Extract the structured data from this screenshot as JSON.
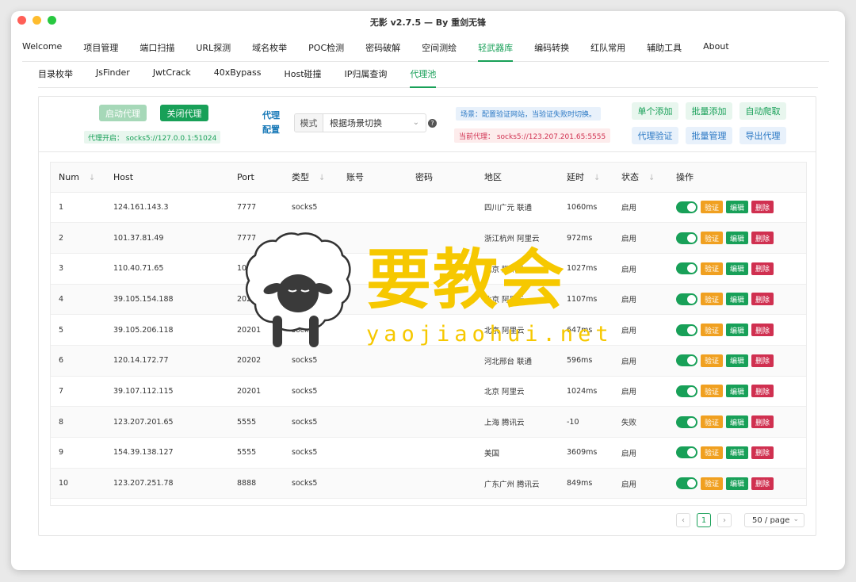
{
  "window": {
    "title": "无影 v2.7.5 — By 重剑无锋"
  },
  "main_tabs": [
    {
      "label": "Welcome"
    },
    {
      "label": "项目管理"
    },
    {
      "label": "端口扫描"
    },
    {
      "label": "URL探测"
    },
    {
      "label": "域名枚举"
    },
    {
      "label": "POC检测"
    },
    {
      "label": "密码破解"
    },
    {
      "label": "空间测绘"
    },
    {
      "label": "轻武器库"
    },
    {
      "label": "编码转换"
    },
    {
      "label": "红队常用"
    },
    {
      "label": "辅助工具"
    },
    {
      "label": "About"
    }
  ],
  "active_main_tab": "轻武器库",
  "sub_tabs": [
    {
      "label": "目录枚举"
    },
    {
      "label": "JsFinder"
    },
    {
      "label": "JwtCrack"
    },
    {
      "label": "40xBypass"
    },
    {
      "label": "Host碰撞"
    },
    {
      "label": "IP归属查询"
    },
    {
      "label": "代理池"
    }
  ],
  "active_sub_tab": "代理池",
  "toolbar": {
    "start_label": "启动代理",
    "stop_label": "关闭代理",
    "proxy_on_text": "代理开启： socks5://127.0.0.1:51024",
    "config_label": "代理配置",
    "mode_prefix": "模式",
    "mode_value": "根据场景切换",
    "help_icon": "?",
    "scene_text": "场景：配置验证网站，当验证失败时切换。",
    "current_proxy_text": "当前代理： socks5://123.207.201.65:5555",
    "add_one": "单个添加",
    "add_batch": "批量添加",
    "auto_crawl": "自动爬取",
    "verify": "代理验证",
    "batch_manage": "批量管理",
    "export": "导出代理"
  },
  "table": {
    "columns": [
      "Num",
      "Host",
      "Port",
      "类型",
      "账号",
      "密码",
      "地区",
      "延时",
      "状态",
      "操作"
    ],
    "ops": {
      "verify": "验证",
      "edit": "编辑",
      "delete": "删除"
    },
    "rows": [
      {
        "num": "1",
        "host": "124.161.143.3",
        "port": "7777",
        "type": "socks5",
        "account": "",
        "password": "",
        "region": "四川广元 联通",
        "delay": "1060ms",
        "status": "启用"
      },
      {
        "num": "2",
        "host": "101.37.81.49",
        "port": "7777",
        "type": "socks5",
        "account": "",
        "password": "",
        "region": "浙江杭州 阿里云",
        "delay": "972ms",
        "status": "启用"
      },
      {
        "num": "3",
        "host": "110.40.71.65",
        "port": "1080",
        "type": "socks5",
        "account": "",
        "password": "",
        "region": "北京 腾讯云",
        "delay": "1027ms",
        "status": "启用"
      },
      {
        "num": "4",
        "host": "39.105.154.188",
        "port": "20201",
        "type": "socks5",
        "account": "",
        "password": "",
        "region": "北京 阿里云",
        "delay": "1107ms",
        "status": "启用"
      },
      {
        "num": "5",
        "host": "39.105.206.118",
        "port": "20201",
        "type": "socks5",
        "account": "",
        "password": "",
        "region": "北京 阿里云",
        "delay": "647ms",
        "status": "启用"
      },
      {
        "num": "6",
        "host": "120.14.172.77",
        "port": "20202",
        "type": "socks5",
        "account": "",
        "password": "",
        "region": "河北邢台 联通",
        "delay": "596ms",
        "status": "启用"
      },
      {
        "num": "7",
        "host": "39.107.112.115",
        "port": "20201",
        "type": "socks5",
        "account": "",
        "password": "",
        "region": "北京 阿里云",
        "delay": "1024ms",
        "status": "启用"
      },
      {
        "num": "8",
        "host": "123.207.201.65",
        "port": "5555",
        "type": "socks5",
        "account": "",
        "password": "",
        "region": "上海 腾讯云",
        "delay": "-10",
        "status": "失败"
      },
      {
        "num": "9",
        "host": "154.39.138.127",
        "port": "5555",
        "type": "socks5",
        "account": "",
        "password": "",
        "region": "美国",
        "delay": "3609ms",
        "status": "启用"
      },
      {
        "num": "10",
        "host": "123.207.251.78",
        "port": "8888",
        "type": "socks5",
        "account": "",
        "password": "",
        "region": "广东广州 腾讯云",
        "delay": "849ms",
        "status": "启用"
      }
    ]
  },
  "pager": {
    "prev": "‹",
    "current_page": "1",
    "next": "›",
    "page_size": "50 / page"
  },
  "watermark": {
    "cn": "要教会",
    "url": "yaojiaohui.net"
  },
  "colors": {
    "accent": "#18a058",
    "warning": "#f0a020",
    "danger": "#d03050",
    "info": "#2a78c4",
    "watermark": "#f6c800"
  }
}
